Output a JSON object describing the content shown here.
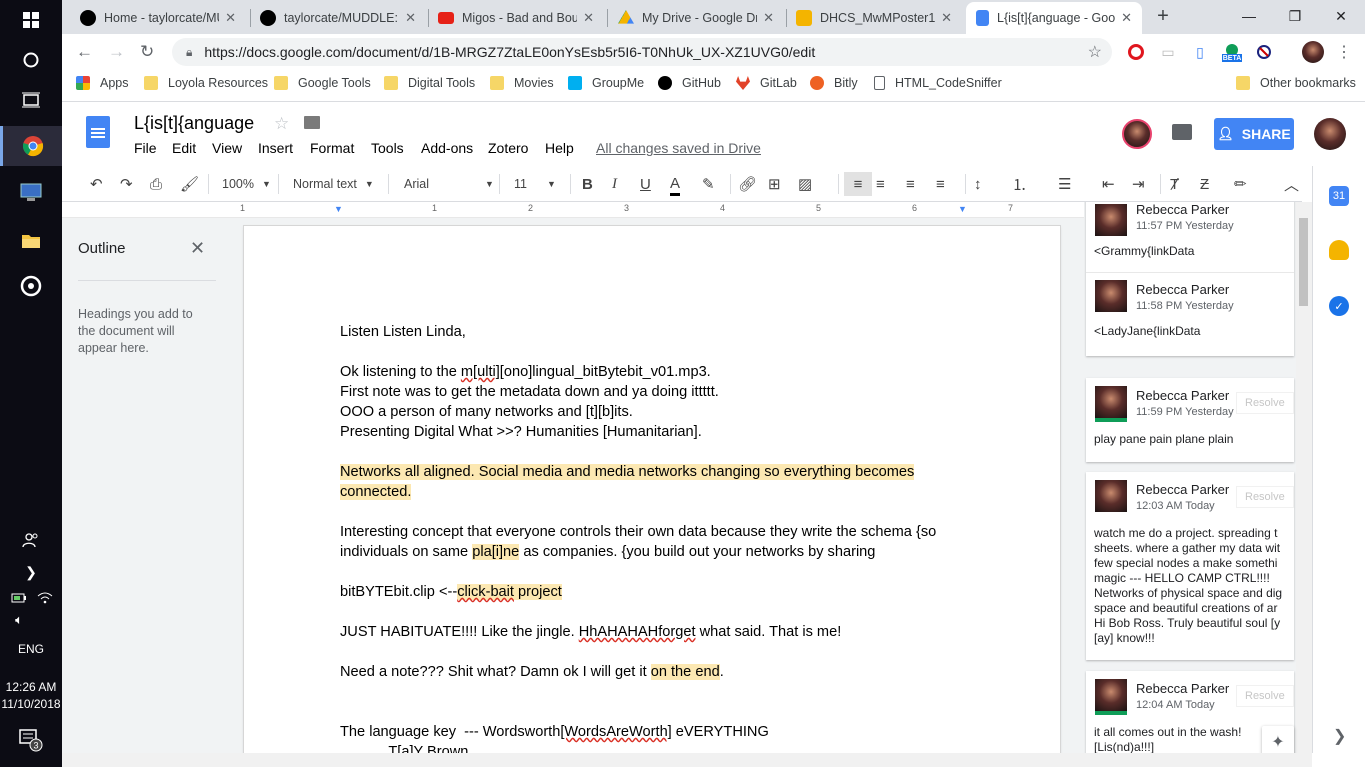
{
  "taskbar": {
    "time": "12:26 AM",
    "date": "11/10/2018",
    "language": "ENG",
    "notification_count": "3"
  },
  "tabs": [
    {
      "title": "Home - taylorcate/MU",
      "icon": "github-icon"
    },
    {
      "title": "taylorcate/MUDDLE: T",
      "icon": "github-icon"
    },
    {
      "title": "Migos - Bad and Bou",
      "icon": "youtube-icon"
    },
    {
      "title": "My Drive - Google Dr",
      "icon": "drive-icon"
    },
    {
      "title": "DHCS_MwMPoster1 -",
      "icon": "slides-icon"
    },
    {
      "title": "L{is[t]{anguage - Goo",
      "icon": "docs-icon"
    }
  ],
  "address": {
    "url": "https://docs.google.com/document/d/1B-MRGZ7ZtaLE0onYsEsb5r5I6-T0NhUk_UX-XZ1UVG0/edit"
  },
  "bookmarks": [
    {
      "label": "Apps",
      "icon": "apps-icon"
    },
    {
      "label": "Loyola Resources",
      "icon": "folder-icon"
    },
    {
      "label": "Google Tools",
      "icon": "folder-icon"
    },
    {
      "label": "Digital Tools",
      "icon": "folder-icon"
    },
    {
      "label": "Movies",
      "icon": "folder-icon"
    },
    {
      "label": "GroupMe",
      "icon": "groupme-icon"
    },
    {
      "label": "GitHub",
      "icon": "github-icon"
    },
    {
      "label": "GitLab",
      "icon": "gitlab-icon"
    },
    {
      "label": "Bitly",
      "icon": "bitly-icon"
    },
    {
      "label": "HTML_CodeSniffer",
      "icon": "page-icon"
    }
  ],
  "bookmarks_other": "Other bookmarks",
  "ext_beta": "BETA",
  "doc": {
    "title": "L{is[t]{anguage",
    "menu": [
      "File",
      "Edit",
      "View",
      "Insert",
      "Format",
      "Tools",
      "Add-ons",
      "Zotero",
      "Help"
    ],
    "saved_status": "All changes saved in Drive",
    "share_label": "SHARE"
  },
  "toolbar": {
    "zoom": "100%",
    "style": "Normal text",
    "font": "Arial",
    "size": "11"
  },
  "ruler": [
    "1",
    "1",
    "2",
    "3",
    "4",
    "5",
    "6",
    "7"
  ],
  "outline": {
    "title": "Outline",
    "hint": "Headings you add to the document will appear here."
  },
  "body": {
    "p1": "Listen Listen Linda,",
    "p2a": "Ok listening to the ",
    "p2b": "m[ulti]",
    "p2c": "[ono]lingual_bitBytebit_v01.mp3.",
    "p3": "First note was to get the metadata down and ya doing ittttt.",
    "p4": "OOO a person of many networks and [t][b]its.",
    "p5": "Presenting Digital What >>? Humanities [Humanitarian].",
    "p6": "Networks all aligned. Social media and media networks changing so everything becomes",
    "p7": "connected.",
    "p8": "Interesting concept that everyone controls their own data because they write the schema {so",
    "p9a": "individuals on same ",
    "p9b": "pla[i]ne",
    "p9c": " as companies. {you build out your networks by sharing",
    "p10a": "bitBYTEbit.clip <--",
    "p10b": "click-bait",
    "p10c": " project",
    "p11a": "JUST HABITUATE!!!! Like the jingle. ",
    "p11b": "HhAHAHAHforget",
    "p11c": " what said. That is me!",
    "p12a": "Need a note??? Shit what? Damn ok I will get it ",
    "p12b": "on the end",
    "p12c": ".",
    "p13a": "The language key  --- Wordsworth",
    "p13b": "[WordsAreWorth]",
    "p13c": " eVERYTHING",
    "p14": "            T[a]Y Brown"
  },
  "comments": [
    {
      "name": "Rebecca Parker",
      "time": "11:57 PM Yesterday",
      "text": "<Grammy{linkData"
    },
    {
      "name": "Rebecca Parker",
      "time": "11:58 PM Yesterday",
      "text": "<LadyJane{linkData"
    },
    {
      "name": "Rebecca Parker",
      "time": "11:59 PM Yesterday",
      "resolve": "Resolve",
      "text": "play pane pain plane plain"
    },
    {
      "name": "Rebecca Parker",
      "time": "12:03 AM Today",
      "resolve": "Resolve",
      "text": "watch me do a project. spreading t\nsheets. where a gather my data wit\nfew special nodes a make somethi\nmagic --- HELLO CAMP CTRL!!!!\nNetworks of physical space and dig\nspace and beautiful creations of ar\nHi Bob Ross. Truly beautiful soul [y\n[ay] know!!!"
    },
    {
      "name": "Rebecca Parker",
      "time": "12:04 AM Today",
      "resolve": "Resolve",
      "text": "it all comes out in the wash!\n[Lis(nd)a!!!]"
    }
  ],
  "side_apps": [
    {
      "label": "31",
      "icon": "calendar-icon"
    },
    {
      "label": "",
      "icon": "keep-icon"
    },
    {
      "label": "",
      "icon": "tasks-icon"
    }
  ],
  "colors": {
    "accent": "#4285f4",
    "highlight": "#fce8b2"
  }
}
